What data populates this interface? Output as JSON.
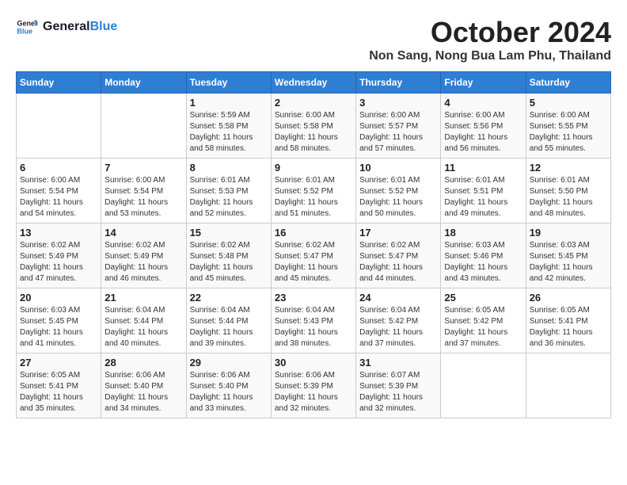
{
  "header": {
    "logo_line1": "General",
    "logo_line2": "Blue",
    "month": "October 2024",
    "location": "Non Sang, Nong Bua Lam Phu, Thailand"
  },
  "weekdays": [
    "Sunday",
    "Monday",
    "Tuesday",
    "Wednesday",
    "Thursday",
    "Friday",
    "Saturday"
  ],
  "weeks": [
    [
      {
        "day": "",
        "info": ""
      },
      {
        "day": "",
        "info": ""
      },
      {
        "day": "1",
        "info": "Sunrise: 5:59 AM\nSunset: 5:58 PM\nDaylight: 11 hours and 58 minutes."
      },
      {
        "day": "2",
        "info": "Sunrise: 6:00 AM\nSunset: 5:58 PM\nDaylight: 11 hours and 58 minutes."
      },
      {
        "day": "3",
        "info": "Sunrise: 6:00 AM\nSunset: 5:57 PM\nDaylight: 11 hours and 57 minutes."
      },
      {
        "day": "4",
        "info": "Sunrise: 6:00 AM\nSunset: 5:56 PM\nDaylight: 11 hours and 56 minutes."
      },
      {
        "day": "5",
        "info": "Sunrise: 6:00 AM\nSunset: 5:55 PM\nDaylight: 11 hours and 55 minutes."
      }
    ],
    [
      {
        "day": "6",
        "info": "Sunrise: 6:00 AM\nSunset: 5:54 PM\nDaylight: 11 hours and 54 minutes."
      },
      {
        "day": "7",
        "info": "Sunrise: 6:00 AM\nSunset: 5:54 PM\nDaylight: 11 hours and 53 minutes."
      },
      {
        "day": "8",
        "info": "Sunrise: 6:01 AM\nSunset: 5:53 PM\nDaylight: 11 hours and 52 minutes."
      },
      {
        "day": "9",
        "info": "Sunrise: 6:01 AM\nSunset: 5:52 PM\nDaylight: 11 hours and 51 minutes."
      },
      {
        "day": "10",
        "info": "Sunrise: 6:01 AM\nSunset: 5:52 PM\nDaylight: 11 hours and 50 minutes."
      },
      {
        "day": "11",
        "info": "Sunrise: 6:01 AM\nSunset: 5:51 PM\nDaylight: 11 hours and 49 minutes."
      },
      {
        "day": "12",
        "info": "Sunrise: 6:01 AM\nSunset: 5:50 PM\nDaylight: 11 hours and 48 minutes."
      }
    ],
    [
      {
        "day": "13",
        "info": "Sunrise: 6:02 AM\nSunset: 5:49 PM\nDaylight: 11 hours and 47 minutes."
      },
      {
        "day": "14",
        "info": "Sunrise: 6:02 AM\nSunset: 5:49 PM\nDaylight: 11 hours and 46 minutes."
      },
      {
        "day": "15",
        "info": "Sunrise: 6:02 AM\nSunset: 5:48 PM\nDaylight: 11 hours and 45 minutes."
      },
      {
        "day": "16",
        "info": "Sunrise: 6:02 AM\nSunset: 5:47 PM\nDaylight: 11 hours and 45 minutes."
      },
      {
        "day": "17",
        "info": "Sunrise: 6:02 AM\nSunset: 5:47 PM\nDaylight: 11 hours and 44 minutes."
      },
      {
        "day": "18",
        "info": "Sunrise: 6:03 AM\nSunset: 5:46 PM\nDaylight: 11 hours and 43 minutes."
      },
      {
        "day": "19",
        "info": "Sunrise: 6:03 AM\nSunset: 5:45 PM\nDaylight: 11 hours and 42 minutes."
      }
    ],
    [
      {
        "day": "20",
        "info": "Sunrise: 6:03 AM\nSunset: 5:45 PM\nDaylight: 11 hours and 41 minutes."
      },
      {
        "day": "21",
        "info": "Sunrise: 6:04 AM\nSunset: 5:44 PM\nDaylight: 11 hours and 40 minutes."
      },
      {
        "day": "22",
        "info": "Sunrise: 6:04 AM\nSunset: 5:44 PM\nDaylight: 11 hours and 39 minutes."
      },
      {
        "day": "23",
        "info": "Sunrise: 6:04 AM\nSunset: 5:43 PM\nDaylight: 11 hours and 38 minutes."
      },
      {
        "day": "24",
        "info": "Sunrise: 6:04 AM\nSunset: 5:42 PM\nDaylight: 11 hours and 37 minutes."
      },
      {
        "day": "25",
        "info": "Sunrise: 6:05 AM\nSunset: 5:42 PM\nDaylight: 11 hours and 37 minutes."
      },
      {
        "day": "26",
        "info": "Sunrise: 6:05 AM\nSunset: 5:41 PM\nDaylight: 11 hours and 36 minutes."
      }
    ],
    [
      {
        "day": "27",
        "info": "Sunrise: 6:05 AM\nSunset: 5:41 PM\nDaylight: 11 hours and 35 minutes."
      },
      {
        "day": "28",
        "info": "Sunrise: 6:06 AM\nSunset: 5:40 PM\nDaylight: 11 hours and 34 minutes."
      },
      {
        "day": "29",
        "info": "Sunrise: 6:06 AM\nSunset: 5:40 PM\nDaylight: 11 hours and 33 minutes."
      },
      {
        "day": "30",
        "info": "Sunrise: 6:06 AM\nSunset: 5:39 PM\nDaylight: 11 hours and 32 minutes."
      },
      {
        "day": "31",
        "info": "Sunrise: 6:07 AM\nSunset: 5:39 PM\nDaylight: 11 hours and 32 minutes."
      },
      {
        "day": "",
        "info": ""
      },
      {
        "day": "",
        "info": ""
      }
    ]
  ]
}
